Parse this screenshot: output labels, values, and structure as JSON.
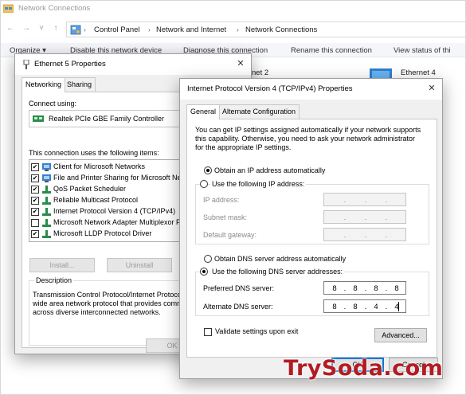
{
  "explorer": {
    "window_title": "Network Connections",
    "breadcrumb": [
      "Control Panel",
      "Network and Internet",
      "Network Connections"
    ],
    "commands": [
      "Organize ▾",
      "Disable this network device",
      "Diagnose this connection",
      "Rename this connection",
      "View status of thi"
    ],
    "items": [
      {
        "name": "net 2"
      },
      {
        "name": "Ethernet 4"
      }
    ]
  },
  "eth_props": {
    "title": "Ethernet 5 Properties",
    "tabs": [
      "Networking",
      "Sharing"
    ],
    "connect_using_label": "Connect using:",
    "adapter_name": "Realtek PCIe GBE Family Controller",
    "items_label": "This connection uses the following items:",
    "items": [
      {
        "label": "Client for Microsoft Networks",
        "checked": true
      },
      {
        "label": "File and Printer Sharing for Microsoft Net",
        "checked": true
      },
      {
        "label": "QoS Packet Scheduler",
        "checked": true
      },
      {
        "label": "Reliable Multicast Protocol",
        "checked": true
      },
      {
        "label": "Internet Protocol Version 4 (TCP/IPv4)",
        "checked": true
      },
      {
        "label": "Microsoft Network Adapter Multiplexor P",
        "checked": false
      },
      {
        "label": "Microsoft LLDP Protocol Driver",
        "checked": true
      }
    ],
    "buttons": {
      "install": "Install...",
      "uninstall": "Uninstall",
      "ok": "OK"
    },
    "description_label": "Description",
    "description_lines": [
      "Transmission Control Protocol/Internet Protoco",
      "wide area network protocol that provides comm",
      "across diverse interconnected networks."
    ]
  },
  "ipv4": {
    "title": "Internet Protocol Version 4 (TCP/IPv4) Properties",
    "tabs": [
      "General",
      "Alternate Configuration"
    ],
    "intro_lines": [
      "You can get IP settings assigned automatically if your network supports",
      "this capability. Otherwise, you need to ask your network administrator",
      "for the appropriate IP settings."
    ],
    "ip_auto_label": "Obtain an IP address automatically",
    "ip_manual_label": "Use the following IP address:",
    "ip_mode": "auto",
    "ip_fields": [
      {
        "label": "IP address:",
        "octets": [
          ".",
          ".",
          "."
        ]
      },
      {
        "label": "Subnet mask:",
        "octets": [
          ".",
          ".",
          "."
        ]
      },
      {
        "label": "Default gateway:",
        "octets": [
          ".",
          ".",
          "."
        ]
      }
    ],
    "dns_auto_label": "Obtain DNS server address automatically",
    "dns_manual_label": "Use the following DNS server addresses:",
    "dns_mode": "manual",
    "preferred_dns_label": "Preferred DNS server:",
    "preferred_dns": [
      "8",
      "8",
      "8",
      "8"
    ],
    "alternate_dns_label": "Alternate DNS server:",
    "alternate_dns": [
      "8",
      "8",
      "4",
      "4"
    ],
    "validate_label": "Validate settings upon exit",
    "validate_checked": false,
    "advanced_label": "Advanced...",
    "ok_label": "OK",
    "cancel_label": "Cancel"
  },
  "watermark": "TrySoda.com",
  "colors": {
    "accent": "#0078d7",
    "watermark": "#b31b22",
    "folder_icon": "#3c8fd6"
  }
}
